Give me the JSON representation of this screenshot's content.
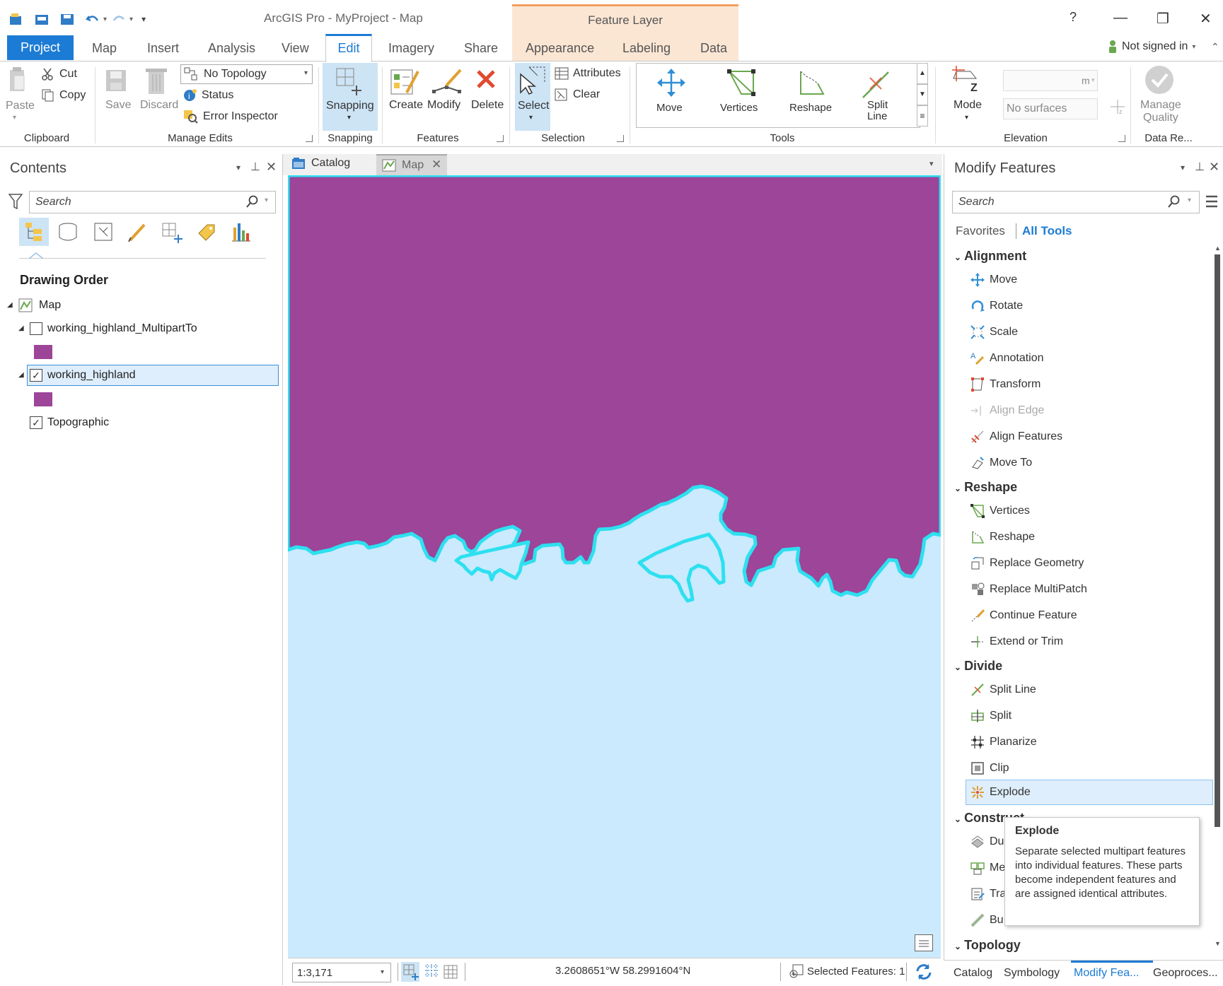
{
  "app": {
    "title": "ArcGIS Pro - MyProject - Map",
    "contextual_group": "Feature Layer",
    "help": "?",
    "signin": "Not signed in"
  },
  "tabs": {
    "project": "Project",
    "map": "Map",
    "insert": "Insert",
    "analysis": "Analysis",
    "view": "View",
    "edit": "Edit",
    "imagery": "Imagery",
    "share": "Share",
    "appearance": "Appearance",
    "labeling": "Labeling",
    "data": "Data"
  },
  "ribbon": {
    "clipboard": {
      "group": "Clipboard",
      "paste": "Paste",
      "cut": "Cut",
      "copy": "Copy"
    },
    "manage_edits": {
      "group": "Manage Edits",
      "save": "Save",
      "discard": "Discard",
      "topology": "No Topology",
      "status": "Status",
      "error_inspector": "Error Inspector"
    },
    "snapping": {
      "group": "Snapping",
      "button": "Snapping"
    },
    "features": {
      "group": "Features",
      "create": "Create",
      "modify": "Modify",
      "delete": "Delete"
    },
    "selection": {
      "group": "Selection",
      "select": "Select",
      "attributes": "Attributes",
      "clear": "Clear"
    },
    "tools": {
      "group": "Tools",
      "move": "Move",
      "vertices": "Vertices",
      "reshape": "Reshape",
      "split_line_1": "Split",
      "split_line_2": "Line"
    },
    "elevation": {
      "group": "Elevation",
      "mode": "Mode",
      "units": "m",
      "surface": "No surfaces"
    },
    "data_reviewer": {
      "group": "Data Re...",
      "manage_1": "Manage",
      "manage_2": "Quality"
    }
  },
  "contents": {
    "title": "Contents",
    "search_placeholder": "Search",
    "drawing_order": "Drawing Order",
    "layers": [
      {
        "name": "Map"
      },
      {
        "name": "working_highland_MultipartTo",
        "checked": false
      },
      {
        "name": "working_highland",
        "checked": true
      },
      {
        "name": "Topographic",
        "checked": true
      }
    ],
    "check_mark": "✓"
  },
  "map_view": {
    "tab_catalog": "Catalog",
    "tab_map": "Map",
    "scale": "1:3,171",
    "coordinates": "3.2608651°W 58.2991604°N",
    "selected_features": "Selected Features: 1",
    "colors": {
      "land": "#9c4599",
      "water": "#cbeafd",
      "selection": "#2de0f0"
    }
  },
  "modify_features": {
    "title": "Modify Features",
    "search_placeholder": "Search",
    "favorites": "Favorites",
    "all_tools": "All Tools",
    "sections": {
      "alignment": "Alignment",
      "reshape": "Reshape",
      "divide": "Divide",
      "construct": "Construct",
      "topology": "Topology"
    },
    "alignment_items": [
      "Move",
      "Rotate",
      "Scale",
      "Annotation",
      "Transform",
      "Align Edge",
      "Align Features",
      "Move To"
    ],
    "reshape_items": [
      "Vertices",
      "Reshape",
      "Replace Geometry",
      "Replace MultiPatch",
      "Continue Feature",
      "Extend or Trim"
    ],
    "divide_items": [
      "Split Line",
      "Split",
      "Planarize",
      "Clip",
      "Explode"
    ],
    "construct_items": [
      "Du",
      "Me",
      "Tra",
      "Bu"
    ]
  },
  "tooltip": {
    "title": "Explode",
    "body": "Separate selected multipart features into individual features. These parts become independent features and are assigned identical attributes."
  },
  "bottom_tabs": {
    "catalog": "Catalog",
    "symbology": "Symbology",
    "modify": "Modify Fea...",
    "geoprocessing": "Geoproces..."
  }
}
